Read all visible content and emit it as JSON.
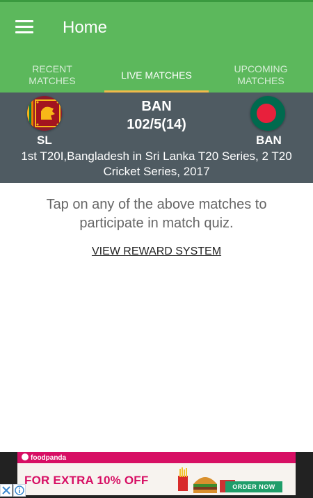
{
  "header": {
    "title": "Home"
  },
  "tabs": [
    {
      "line1": "RECENT",
      "line2": "MATCHES",
      "active": false
    },
    {
      "line1": "LIVE MATCHES",
      "line2": "",
      "active": true
    },
    {
      "line1": "UPCOMING",
      "line2": "MATCHES",
      "active": false
    }
  ],
  "match": {
    "team_left": "SL",
    "team_right": "BAN",
    "batting_team": "BAN",
    "score": "102/5(14)",
    "series": "1st T20I,Bangladesh in Sri Lanka T20 Series, 2 T20 Cricket Series, 2017"
  },
  "message": "Tap on any of the above matches to participate in match quiz.",
  "reward_link": "VIEW REWARD SYSTEM",
  "ad": {
    "brand": "foodpanda",
    "headline": "FOR EXTRA 10% OFF",
    "cta": "ORDER NOW"
  },
  "colors": {
    "appbar": "#5cb85c",
    "tab_indicator": "#f0b94a",
    "match_card": "#4f5b62",
    "ad_brand": "#d70f64",
    "ad_cta": "#1f9e6a"
  }
}
